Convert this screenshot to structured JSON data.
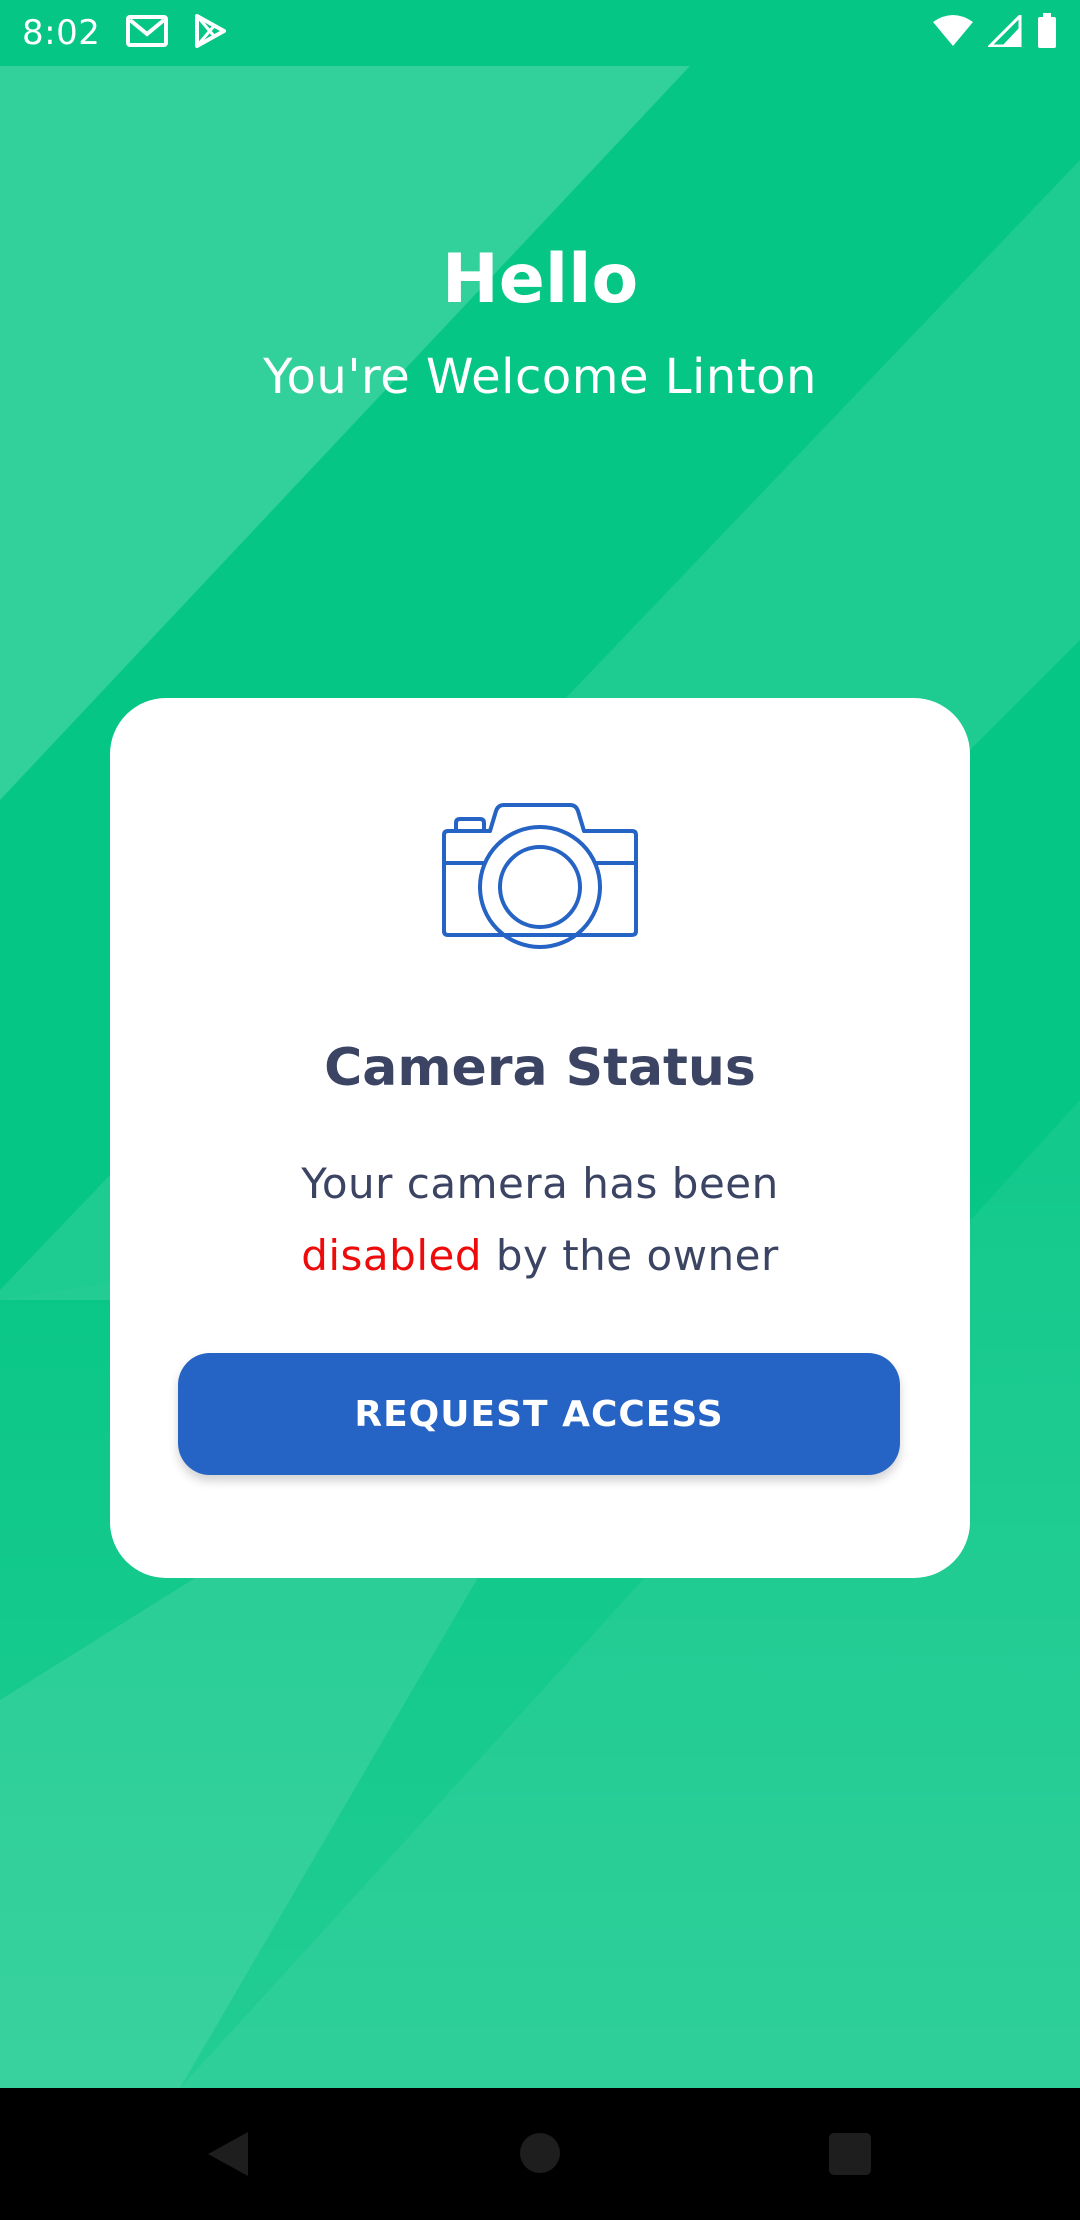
{
  "status_bar": {
    "time": "8:02",
    "notification_icons": [
      "gmail-icon",
      "play-store-icon"
    ],
    "system_icons": [
      "wifi-icon",
      "cellular-signal-icon",
      "battery-icon"
    ]
  },
  "greeting": {
    "title": "Hello",
    "subtitle": "You're Welcome Linton"
  },
  "card": {
    "icon": "camera-icon",
    "title": "Camera Status",
    "message_line1": "Your camera has been",
    "message_highlight": "disabled",
    "message_line2_rest": " by the owner",
    "button_label": "REQUEST ACCESS"
  },
  "nav_bar": {
    "buttons": [
      "back-icon",
      "home-icon",
      "recents-icon"
    ]
  },
  "colors": {
    "background_green": "#05c685",
    "card_white": "#ffffff",
    "text_dark": "#3c4463",
    "highlight_red": "#ee0b0b",
    "button_blue": "#2563c4",
    "icon_blue": "#2563c4"
  }
}
